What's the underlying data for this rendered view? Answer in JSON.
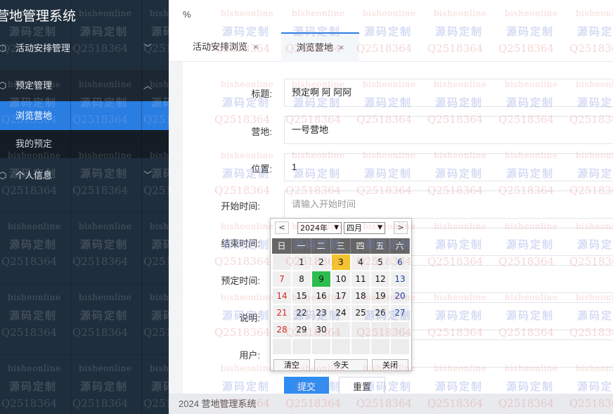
{
  "app": {
    "title": "营地管理系统"
  },
  "sidebar": {
    "groups": [
      {
        "label": "活动安排管理",
        "expanded": false,
        "icon": "cube-icon"
      },
      {
        "label": "预定管理",
        "expanded": true,
        "icon": "cube-icon",
        "items": [
          {
            "label": "浏览营地",
            "active": true
          },
          {
            "label": "我的预定",
            "active": false
          }
        ]
      },
      {
        "label": "个人信息",
        "expanded": false,
        "icon": "cube-icon"
      }
    ]
  },
  "header": {
    "zoom_text": "%"
  },
  "tabs": [
    {
      "label": "活动安排浏览",
      "active": false
    },
    {
      "label": "浏览营地",
      "active": true
    }
  ],
  "form": {
    "fields": [
      {
        "label": "标题:",
        "value": "预定啊 阿 阿阿"
      },
      {
        "label": "营地:",
        "value": "一号营地"
      },
      {
        "label": "位置:",
        "value": "1"
      },
      {
        "label": "开始时间:",
        "value": "",
        "placeholder": "请输入开始时间"
      },
      {
        "label": "结束时间:",
        "value": ""
      },
      {
        "label": "预定时间:",
        "value": ""
      },
      {
        "label": "说明:",
        "value": ""
      },
      {
        "label": "用户:",
        "value": ""
      }
    ],
    "submit_label": "提交",
    "reset_label": "重置"
  },
  "datepicker": {
    "prev": "<",
    "next": ">",
    "year": "2024年",
    "month": "四月",
    "weekdays": [
      "日",
      "一",
      "二",
      "三",
      "四",
      "五",
      "六"
    ],
    "weeks": [
      [
        "",
        "1",
        "2",
        "3",
        "4",
        "5",
        "6"
      ],
      [
        "7",
        "8",
        "9",
        "10",
        "11",
        "12",
        "13"
      ],
      [
        "14",
        "15",
        "16",
        "17",
        "18",
        "19",
        "20"
      ],
      [
        "21",
        "22",
        "23",
        "24",
        "25",
        "26",
        "27"
      ],
      [
        "28",
        "29",
        "30",
        "",
        "",
        "",
        ""
      ],
      [
        "",
        "",
        "",
        "",
        "",
        "",
        ""
      ]
    ],
    "today": "3",
    "selected": "9",
    "clear_label": "清空",
    "today_label": "今天",
    "close_label": "关闭"
  },
  "footer": {
    "text": "2024 营地管理系统"
  },
  "watermark": {
    "line1": "bisheonline",
    "line2": "源码定制",
    "line3": "Q2518364"
  },
  "colors": {
    "sidebar_bg": "#1f2e3d",
    "active_item": "#2a7de1",
    "primary_button": "#2f8cf0",
    "today_cell": "#f4c430",
    "selected_cell": "#2dbd4e"
  }
}
